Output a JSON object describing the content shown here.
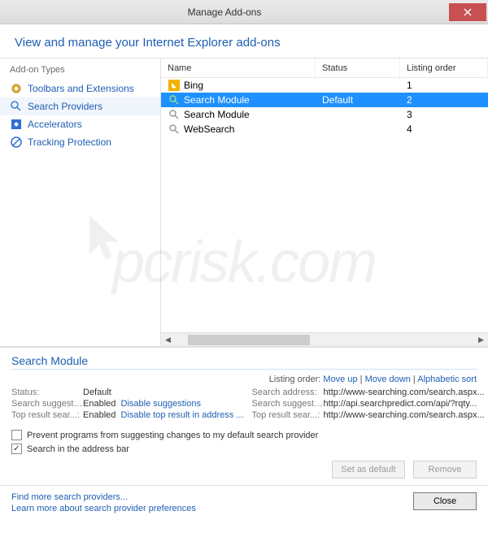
{
  "window": {
    "title": "Manage Add-ons"
  },
  "header": {
    "text": "View and manage your Internet Explorer add-ons"
  },
  "sidebar": {
    "heading": "Add-on Types",
    "items": [
      {
        "label": "Toolbars and Extensions",
        "icon": "gear-icon"
      },
      {
        "label": "Search Providers",
        "icon": "search-icon"
      },
      {
        "label": "Accelerators",
        "icon": "accelerator-icon"
      },
      {
        "label": "Tracking Protection",
        "icon": "shield-icon"
      }
    ],
    "selected": 1
  },
  "columns": {
    "name": "Name",
    "status": "Status",
    "order": "Listing order"
  },
  "providers": [
    {
      "name": "Bing",
      "status": "",
      "order": "1",
      "icon": "bing-icon"
    },
    {
      "name": "Search Module",
      "status": "Default",
      "order": "2",
      "icon": "search-green-icon"
    },
    {
      "name": "Search Module",
      "status": "",
      "order": "3",
      "icon": "search-grey-icon"
    },
    {
      "name": "WebSearch",
      "status": "",
      "order": "4",
      "icon": "search-grey-icon"
    }
  ],
  "selected_row": 1,
  "detail": {
    "title": "Search Module",
    "ordering": {
      "label": "Listing order:",
      "moveup": "Move up",
      "movedown": "Move down",
      "sort": "Alphabetic sort"
    },
    "left": {
      "status_k": "Status:",
      "status_v": "Default",
      "suggest_k": "Search suggest...:",
      "suggest_v": "Enabled",
      "suggest_link": "Disable suggestions",
      "top_k": "Top result sear...:",
      "top_v": "Enabled",
      "top_link": "Disable top result in address ..."
    },
    "right": {
      "addr_k": "Search address:",
      "addr_v": "http://www-searching.com/search.aspx...",
      "sug_k": "Search suggest...:",
      "sug_v": "http://api.searchpredict.com/api/?rqty...",
      "top_k": "Top result sear...:",
      "top_v": "http://www-searching.com/search.aspx..."
    },
    "check1": "Prevent programs from suggesting changes to my default search provider",
    "check2": "Search in the address bar",
    "btn_setdefault": "Set as default",
    "btn_remove": "Remove"
  },
  "footer": {
    "link1": "Find more search providers...",
    "link2": "Learn more about search provider preferences",
    "close": "Close"
  },
  "watermark": "pcrisk.com"
}
